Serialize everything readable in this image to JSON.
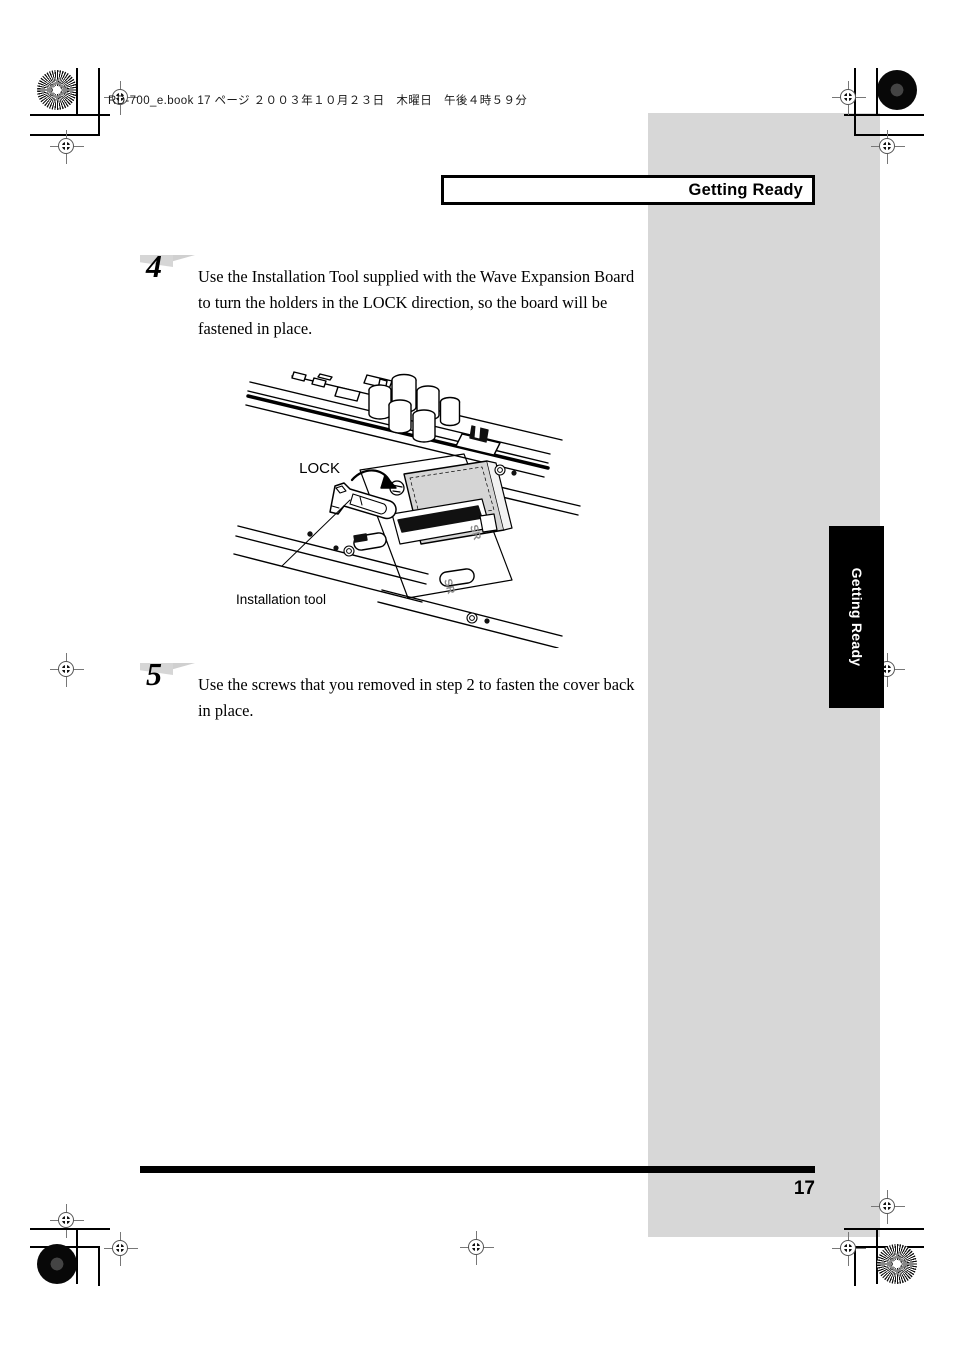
{
  "document": {
    "book_header": "RD-700_e.book 17 ページ ２００３年１０月２３日　木曜日　午後４時５９分",
    "section_title": "Getting Ready",
    "side_tab_label": "Getting Ready",
    "page_number": "17"
  },
  "steps": [
    {
      "number": "4",
      "text": "Use the Installation Tool supplied with the Wave Expansion Board to turn the holders in the LOCK direction, so the board will be fastened in place."
    },
    {
      "number": "5",
      "text": "Use the screws that you removed in step 2 to fasten the cover back in place."
    }
  ],
  "figure": {
    "callout_lock": "LOCK",
    "callout_tool": "Installation tool"
  },
  "colors": {
    "gray_column": "#d7d7d7",
    "board_fill": "#d5d5d5",
    "tab_background": "#000000",
    "tab_text": "#ffffff",
    "rule": "#000000"
  }
}
